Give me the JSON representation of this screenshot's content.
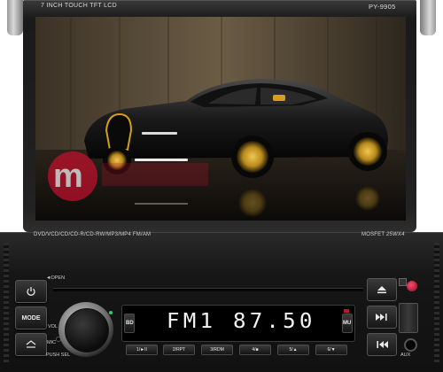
{
  "device": {
    "screen_label": "7  INCH TOUCH TFT LCD",
    "model": "PY-9905",
    "formats": "DVD/VCD/CD/CD-R/CD-RW/MP3/MP4 FM/AM",
    "amp": "MOSFET",
    "power": "25WX4"
  },
  "controls": {
    "open_label": "OPEN",
    "power_icon": "power-icon",
    "mode_label": "MODE",
    "vol_label": "VOL",
    "push_sel_label": "PUSH SEL",
    "mic_label": "MIC",
    "bd_label": "BD",
    "mu_label": "MU",
    "aux_label": "AUX",
    "eject_icon": "eject-icon",
    "next_icon": "skip-forward-icon",
    "prev_icon": "skip-back-icon"
  },
  "display": {
    "text": "FM1  87.50"
  },
  "presets": [
    {
      "label": "1/►II"
    },
    {
      "label": "2/RPT"
    },
    {
      "label": "3/RDM"
    },
    {
      "label": "4/■"
    },
    {
      "label": "5/▲"
    },
    {
      "label": "6/▼"
    }
  ],
  "colors": {
    "body": "#1a1a1a",
    "watermark": "#c8102e",
    "car_trim": "#d4a017"
  }
}
